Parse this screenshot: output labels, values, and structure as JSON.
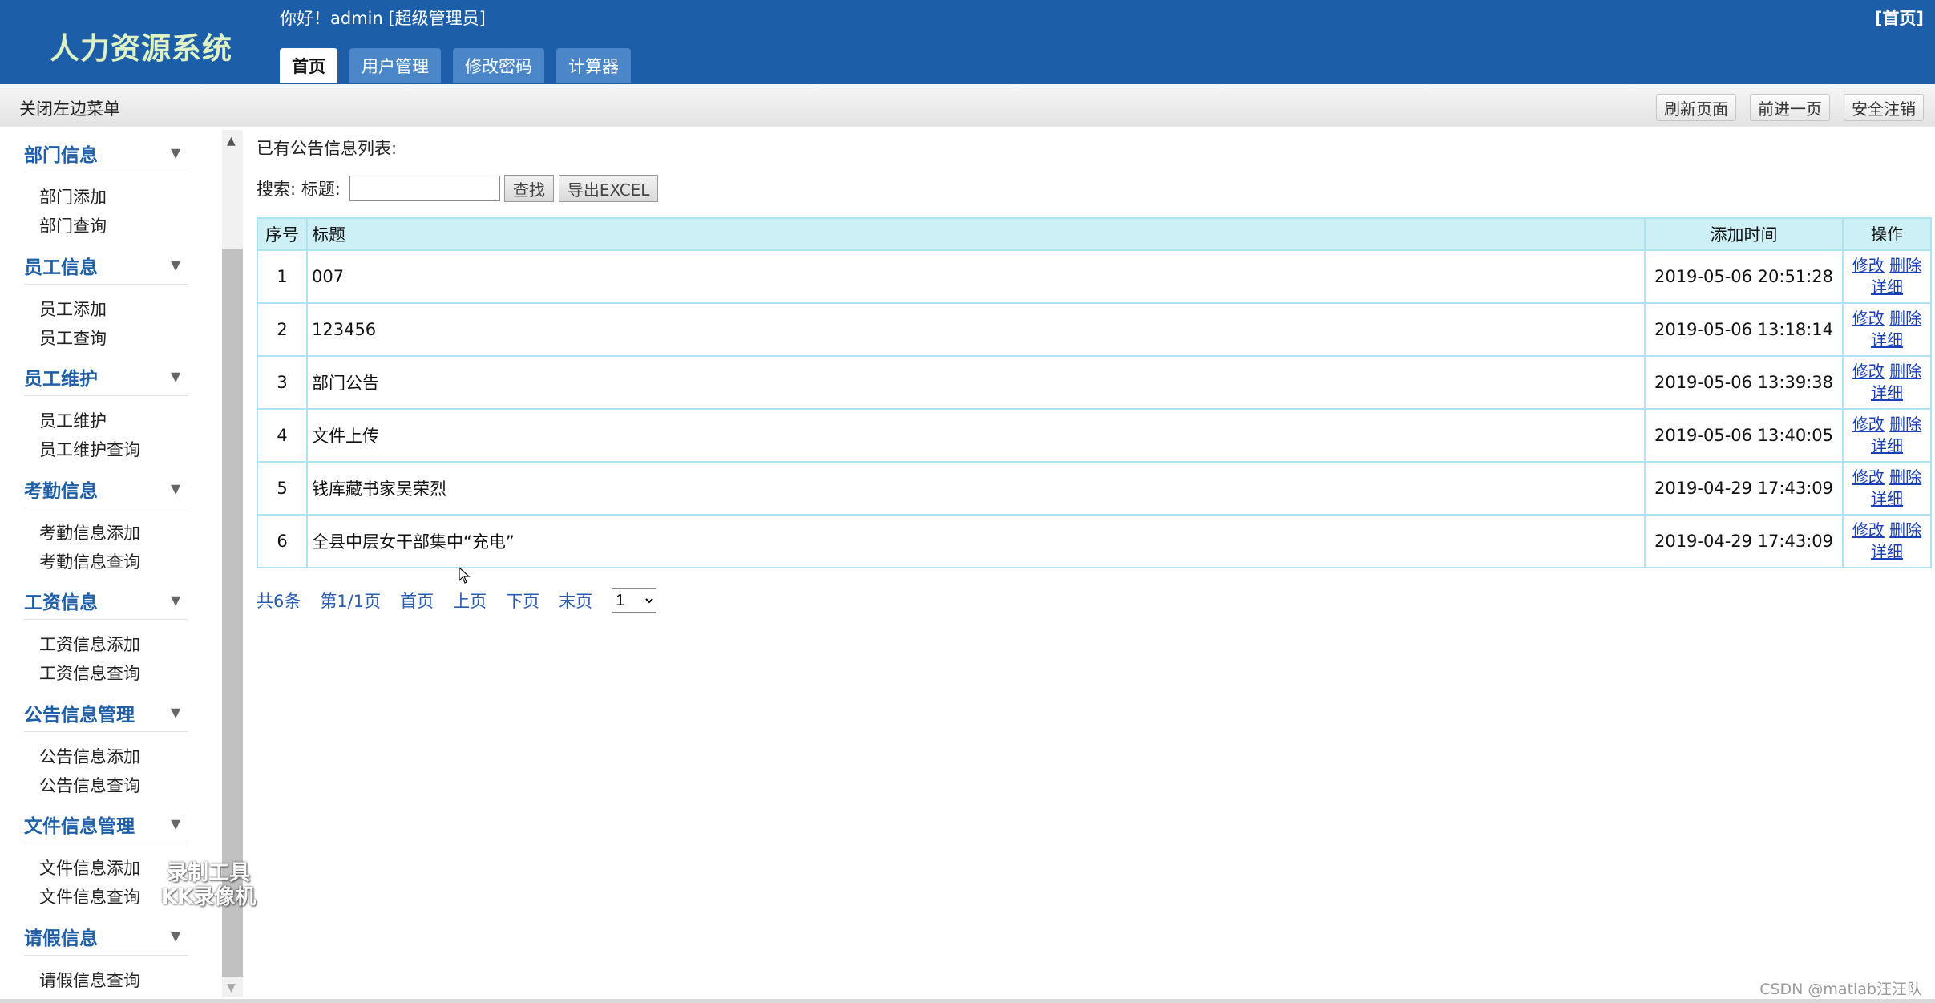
{
  "header": {
    "logo": "人力资源系统",
    "greeting": "你好！admin [超级管理员]",
    "home_link": "[首页]",
    "tabs": [
      {
        "label": "首页",
        "active": true
      },
      {
        "label": "用户管理",
        "active": false
      },
      {
        "label": "修改密码",
        "active": false
      },
      {
        "label": "计算器",
        "active": false
      }
    ]
  },
  "toolbar": {
    "close_menu": "关闭左边菜单",
    "refresh": "刷新页面",
    "forward": "前进一页",
    "logout": "安全注销"
  },
  "sidebar": {
    "groups": [
      {
        "title": "部门信息",
        "items": [
          "部门添加",
          "部门查询"
        ]
      },
      {
        "title": "员工信息",
        "items": [
          "员工添加",
          "员工查询"
        ]
      },
      {
        "title": "员工维护",
        "items": [
          "员工维护",
          "员工维护查询"
        ]
      },
      {
        "title": "考勤信息",
        "items": [
          "考勤信息添加",
          "考勤信息查询"
        ]
      },
      {
        "title": "工资信息",
        "items": [
          "工资信息添加",
          "工资信息查询"
        ]
      },
      {
        "title": "公告信息管理",
        "items": [
          "公告信息添加",
          "公告信息查询"
        ]
      },
      {
        "title": "文件信息管理",
        "items": [
          "文件信息添加",
          "文件信息查询"
        ]
      },
      {
        "title": "请假信息",
        "items": [
          "请假信息查询"
        ]
      }
    ]
  },
  "main": {
    "list_title": "已有公告信息列表:",
    "search_label": "搜索: 标题:",
    "search_value": "",
    "search_button": "查找",
    "export_button": "导出EXCEL",
    "columns": [
      "序号",
      "标题",
      "添加时间",
      "操作"
    ],
    "rows": [
      {
        "idx": "1",
        "title": "007",
        "time": "2019-05-06 20:51:28"
      },
      {
        "idx": "2",
        "title": "123456",
        "time": "2019-05-06 13:18:14"
      },
      {
        "idx": "3",
        "title": "部门公告",
        "time": "2019-05-06 13:39:38"
      },
      {
        "idx": "4",
        "title": "文件上传",
        "time": "2019-05-06 13:40:05"
      },
      {
        "idx": "5",
        "title": "钱库藏书家吴荣烈",
        "time": "2019-04-29 17:43:09"
      },
      {
        "idx": "6",
        "title": "全县中层女干部集中“充电”",
        "time": "2019-04-29 17:43:09"
      }
    ],
    "ops": {
      "edit": "修改",
      "delete": "删除",
      "detail": "详细"
    },
    "pager": {
      "total": "共6条",
      "page_info": "第1/1页",
      "first": "首页",
      "prev": "上页",
      "next": "下页",
      "last": "末页",
      "selected": "1"
    }
  },
  "watermarks": {
    "recorder_line1": "录制工具",
    "recorder_line2": "KK录像机",
    "csdn": "CSDN @matlab汪汪队"
  }
}
